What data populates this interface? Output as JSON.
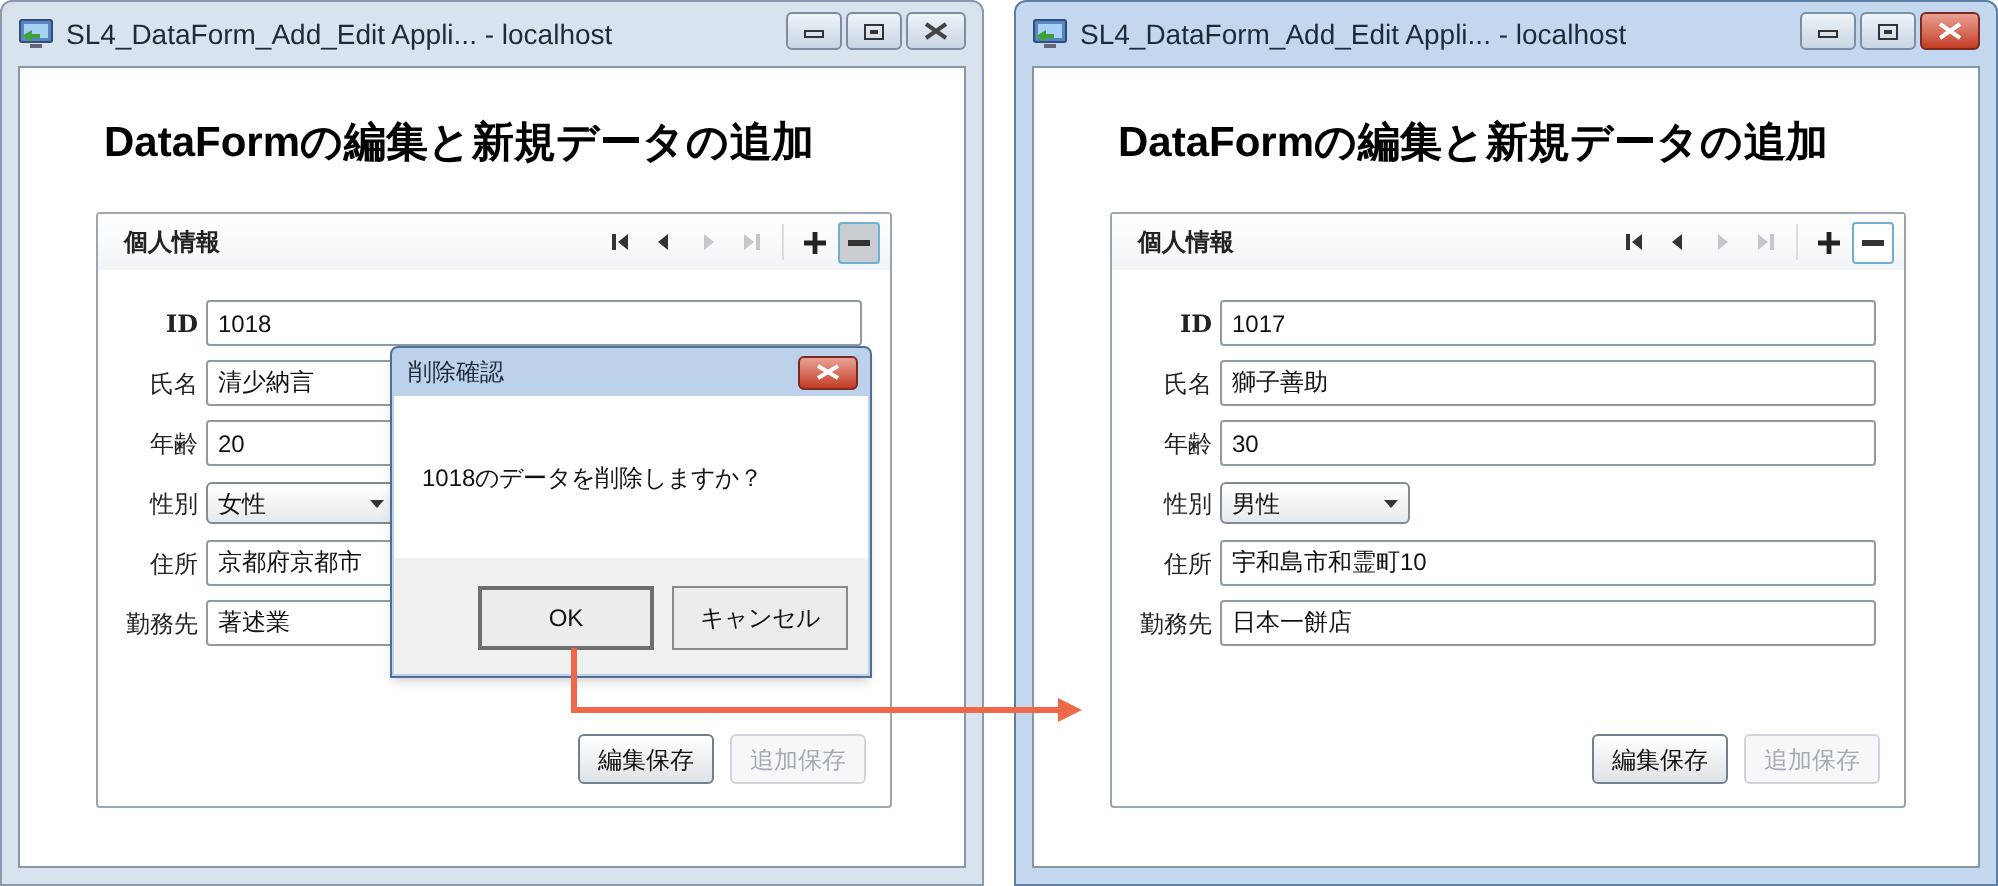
{
  "windows": [
    {
      "title": "SL4_DataForm_Add_Edit Appli... - localhost",
      "active": false,
      "heading": "DataFormの編集と新規データの追加",
      "form": {
        "header": "個人情報",
        "nav": [
          {
            "kind": "first",
            "disabled": false
          },
          {
            "kind": "prev",
            "disabled": false
          },
          {
            "kind": "next",
            "disabled": true
          },
          {
            "kind": "last",
            "disabled": true
          }
        ],
        "delete_pressed": true,
        "fields": [
          {
            "label": "ID",
            "value": "1018",
            "kind": "text",
            "bold": true
          },
          {
            "label": "氏名",
            "value": "清少納言",
            "kind": "text",
            "bold": false
          },
          {
            "label": "年齢",
            "value": "20",
            "kind": "text",
            "bold": false
          },
          {
            "label": "性別",
            "value": "女性",
            "kind": "combo",
            "bold": false
          },
          {
            "label": "住所",
            "value": "京都府京都市",
            "kind": "text",
            "bold": false
          },
          {
            "label": "勤務先",
            "value": "著述業",
            "kind": "text",
            "bold": false
          }
        ],
        "buttons": [
          {
            "label": "編集保存",
            "disabled": false
          },
          {
            "label": "追加保存",
            "disabled": true
          }
        ]
      },
      "dialog": {
        "title": "削除確認",
        "message": "1018のデータを削除しますか？",
        "buttons": [
          {
            "label": "OK",
            "default": true
          },
          {
            "label": "キャンセル",
            "default": false
          }
        ]
      }
    },
    {
      "title": "SL4_DataForm_Add_Edit Appli... - localhost",
      "active": true,
      "heading": "DataFormの編集と新規データの追加",
      "form": {
        "header": "個人情報",
        "nav": [
          {
            "kind": "first",
            "disabled": false
          },
          {
            "kind": "prev",
            "disabled": false
          },
          {
            "kind": "next",
            "disabled": true
          },
          {
            "kind": "last",
            "disabled": true
          }
        ],
        "delete_pressed": false,
        "fields": [
          {
            "label": "ID",
            "value": "1017",
            "kind": "text",
            "bold": true
          },
          {
            "label": "氏名",
            "value": "獅子善助",
            "kind": "text",
            "bold": false
          },
          {
            "label": "年齢",
            "value": "30",
            "kind": "text",
            "bold": false
          },
          {
            "label": "性別",
            "value": "男性",
            "kind": "combo",
            "bold": false
          },
          {
            "label": "住所",
            "value": "宇和島市和霊町10",
            "kind": "text",
            "bold": false
          },
          {
            "label": "勤務先",
            "value": "日本一餅店",
            "kind": "text",
            "bold": false
          }
        ],
        "buttons": [
          {
            "label": "編集保存",
            "disabled": false
          },
          {
            "label": "追加保存",
            "disabled": true
          }
        ]
      }
    }
  ]
}
